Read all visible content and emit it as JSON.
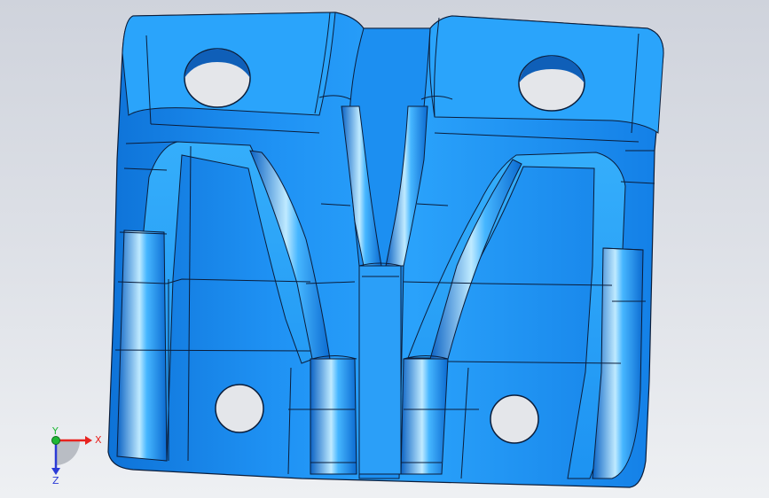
{
  "viewport": {
    "background_top": "#cfd3dc",
    "background_bottom": "#eef0f3"
  },
  "model": {
    "body_color": "#1a8cf0",
    "light_face_color": "#3fb2fb",
    "edge_color": "#0b1d3a",
    "hole_color": "#e4e6ea"
  },
  "triad": {
    "x_label": "X",
    "y_label": "Y",
    "z_label": "Z",
    "x_color": "#e8231f",
    "y_color": "#1fb835",
    "z_color": "#2b3bd6"
  }
}
